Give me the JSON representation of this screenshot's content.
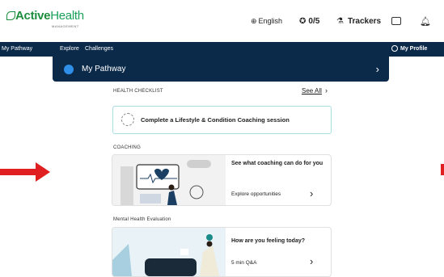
{
  "header": {
    "logo": {
      "brand_a": "Active",
      "brand_b": "Health",
      "sub": "MANAGEMENT"
    },
    "language": "English",
    "points": "0/5",
    "trackers": "Trackers"
  },
  "nav": {
    "items": [
      "My Pathway",
      "Explore",
      "Challenges"
    ],
    "profile": "My Profile"
  },
  "pathway_bar": {
    "title": "My Pathway"
  },
  "health_checklist": {
    "label": "HEALTH CHECKLIST",
    "see_all": "See All",
    "item": "Complete a Lifestyle & Condition Coaching session"
  },
  "coaching": {
    "label": "COACHING",
    "title": "See what coaching can do for you",
    "link": "Explore opportunities"
  },
  "mental_health": {
    "label": "Mental Health Evaluation",
    "title": "How are you feeling today?",
    "link": "5 min Q&A"
  },
  "colors": {
    "navy": "#0b2a4a",
    "teal_border": "#a7dfe0",
    "arrow_red": "#e02020",
    "brand_green": "#1e8e3e"
  }
}
